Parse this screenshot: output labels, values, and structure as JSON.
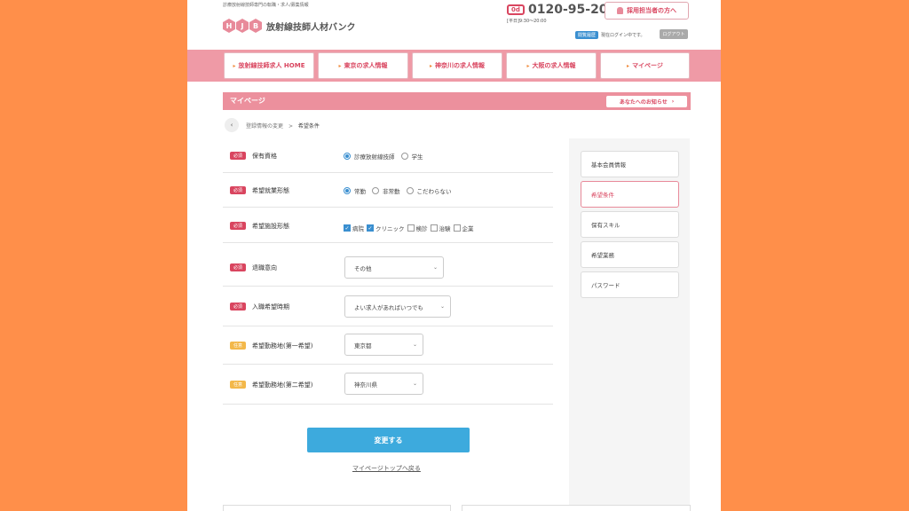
{
  "header": {
    "tagline": "診療放射線技師専門の転職・求人/募集情報",
    "logo_letters": [
      "H",
      "J",
      "B"
    ],
    "logo_text": "放射線技師人材バンク",
    "tel_icon": "0d",
    "tel_number": "0120-95-2076",
    "tel_hours": "[平日]9:30〜20:00",
    "recruiter_button": "採用担当者の方へ",
    "history_badge": "閲覧履歴",
    "login_status": "現在ログイン中です。",
    "logout_button": "ログアウト"
  },
  "nav": {
    "items": [
      "放射線技師求人 HOME",
      "東京の求人情報",
      "神奈川の求人情報",
      "大阪の求人情報",
      "マイページ"
    ]
  },
  "mypage": {
    "title": "マイページ",
    "notice_button": "あなたへのお知らせ"
  },
  "breadcrumb": {
    "back_icon": "‹",
    "parent": "登録情報の変更",
    "separator": ">",
    "current": "希望条件"
  },
  "form": {
    "required_badge": "必須",
    "optional_badge": "任意",
    "qualification": {
      "label": "保有資格",
      "options": [
        "診療放射線技師",
        "学生"
      ],
      "selected": "診療放射線技師"
    },
    "employment": {
      "label": "希望就業形態",
      "options": [
        "常勤",
        "非常勤",
        "こだわらない"
      ],
      "selected": "常勤"
    },
    "facility": {
      "label": "希望施設形態",
      "options": [
        "病院",
        "クリニック",
        "検診",
        "治験",
        "企業"
      ],
      "checked": [
        "病院",
        "クリニック"
      ]
    },
    "intent": {
      "label": "退職意向",
      "value": "その他"
    },
    "timing": {
      "label": "入職希望時期",
      "value": "よい求人があればいつでも"
    },
    "location1": {
      "label": "希望勤務地(第一希望)",
      "value": "東京都"
    },
    "location2": {
      "label": "希望勤務地(第二希望)",
      "value": "神奈川県"
    },
    "submit": "変更する",
    "back_link": "マイページトップへ戻る"
  },
  "sidebar": {
    "items": [
      "基本会員情報",
      "希望条件",
      "保有スキル",
      "希望業務",
      "パスワード"
    ],
    "active": "希望条件"
  },
  "icons": {
    "chevron": "⌄",
    "check": "✓",
    "arrow_right": "›"
  },
  "colors": {
    "background": "#ff8f4a",
    "accent_pink": "#d9455f",
    "nav_pink": "#ef9aa6",
    "button_blue": "#3daadd"
  }
}
